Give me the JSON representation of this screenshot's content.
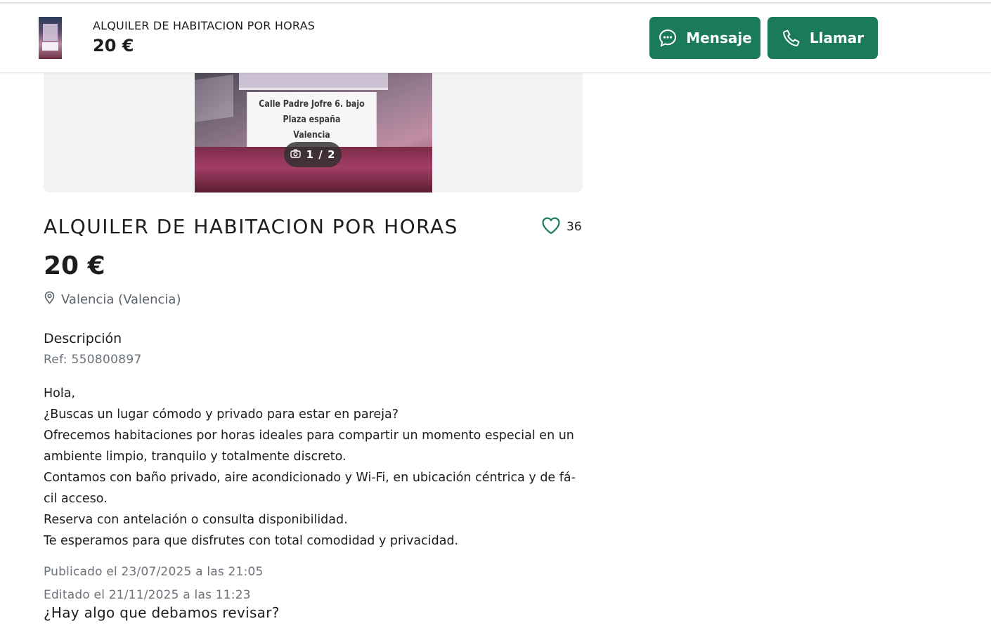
{
  "header": {
    "title": "ALQUILER DE HABITACION POR HORAS",
    "price": "20 €",
    "message_label": "Mensaje",
    "call_label": "Llamar"
  },
  "gallery": {
    "photo_text": [
      "Calle Padre Jofre 6. bajo",
      "Plaza españa",
      "Valencia"
    ],
    "counter": "1 / 2"
  },
  "ad": {
    "title": "ALQUILER DE HABITACION POR HORAS",
    "favorites": "36",
    "price": "20 €",
    "location": "Valencia (Valencia)",
    "description_heading": "Descripción",
    "ref": "Ref: 550800897",
    "description_lines": [
      "Hola,",
      "¿Buscas un lugar cómodo y privado para estar en pareja?",
      "Ofrecemos habitaciones por horas ideales para compartir un momento especial en un",
      "ambiente limpio, tranquilo y totalmente discreto.",
      "Contamos con baño privado, aire acondicionado y Wi-Fi, en ubicación céntrica y de fá-",
      "cil acceso.",
      "Reserva con antelación o consulta disponibilidad.",
      "Te esperamos para que disfrutes con total comodidad y privacidad."
    ],
    "published": "Publicado el 23/07/2025 a las 21:05",
    "edited": "Editado el 21/11/2025 a las 11:23",
    "report": "¿Hay algo que debamos revisar?"
  },
  "colors": {
    "accent": "#1b7a5a",
    "muted_text": "#6b7279"
  },
  "icons": [
    "chat-bubble-icon",
    "phone-icon",
    "camera-icon",
    "heart-icon",
    "location-pin-icon"
  ]
}
